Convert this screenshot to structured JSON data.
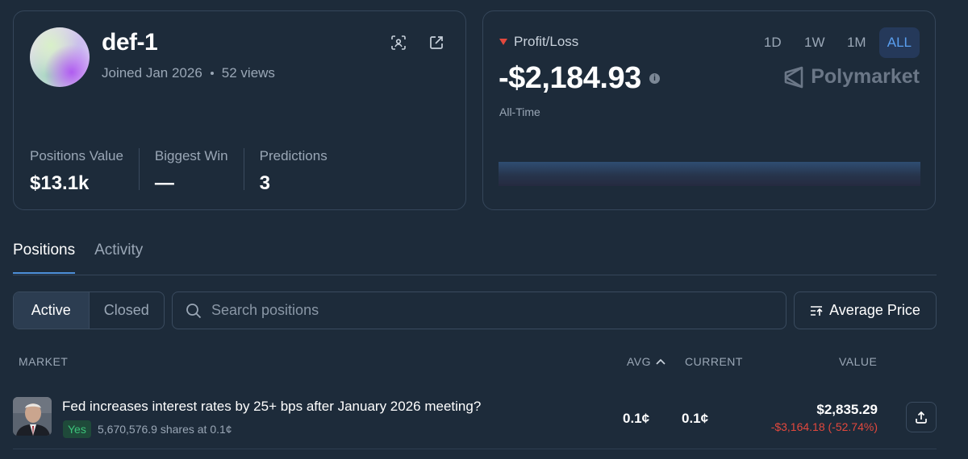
{
  "profile": {
    "username": "def-1",
    "joined": "Joined Jan 2026",
    "views": "52 views",
    "stats": [
      {
        "label": "Positions Value",
        "value": "$13.1k"
      },
      {
        "label": "Biggest Win",
        "value": "—"
      },
      {
        "label": "Predictions",
        "value": "3"
      }
    ]
  },
  "pnl": {
    "label": "Profit/Loss",
    "value": "-$2,184.93",
    "period": "All-Time",
    "ranges": [
      "1D",
      "1W",
      "1M",
      "ALL"
    ],
    "active_range": "ALL",
    "brand": "Polymarket",
    "indicator_color": "#e2483d"
  },
  "tabs": [
    "Positions",
    "Activity"
  ],
  "filters": {
    "active": "Active",
    "closed": "Closed"
  },
  "search": {
    "placeholder": "Search positions"
  },
  "sort": {
    "label": "Average Price"
  },
  "table": {
    "headers": {
      "market": "MARKET",
      "avg": "AVG",
      "current": "CURRENT",
      "value": "VALUE"
    },
    "rows": [
      {
        "title": "Fed increases interest rates by 25+ bps after January 2026 meeting?",
        "outcome": "Yes",
        "shares": "5,670,576.9 shares at 0.1¢",
        "avg": "0.1¢",
        "current": "0.1¢",
        "value": "$2,835.29",
        "change": "-$3,164.18 (-52.74%)"
      }
    ]
  },
  "colors": {
    "accent": "#4d8fd8",
    "negative": "#e2483d",
    "positive": "#3cc27a",
    "background": "#1d2b3a"
  }
}
